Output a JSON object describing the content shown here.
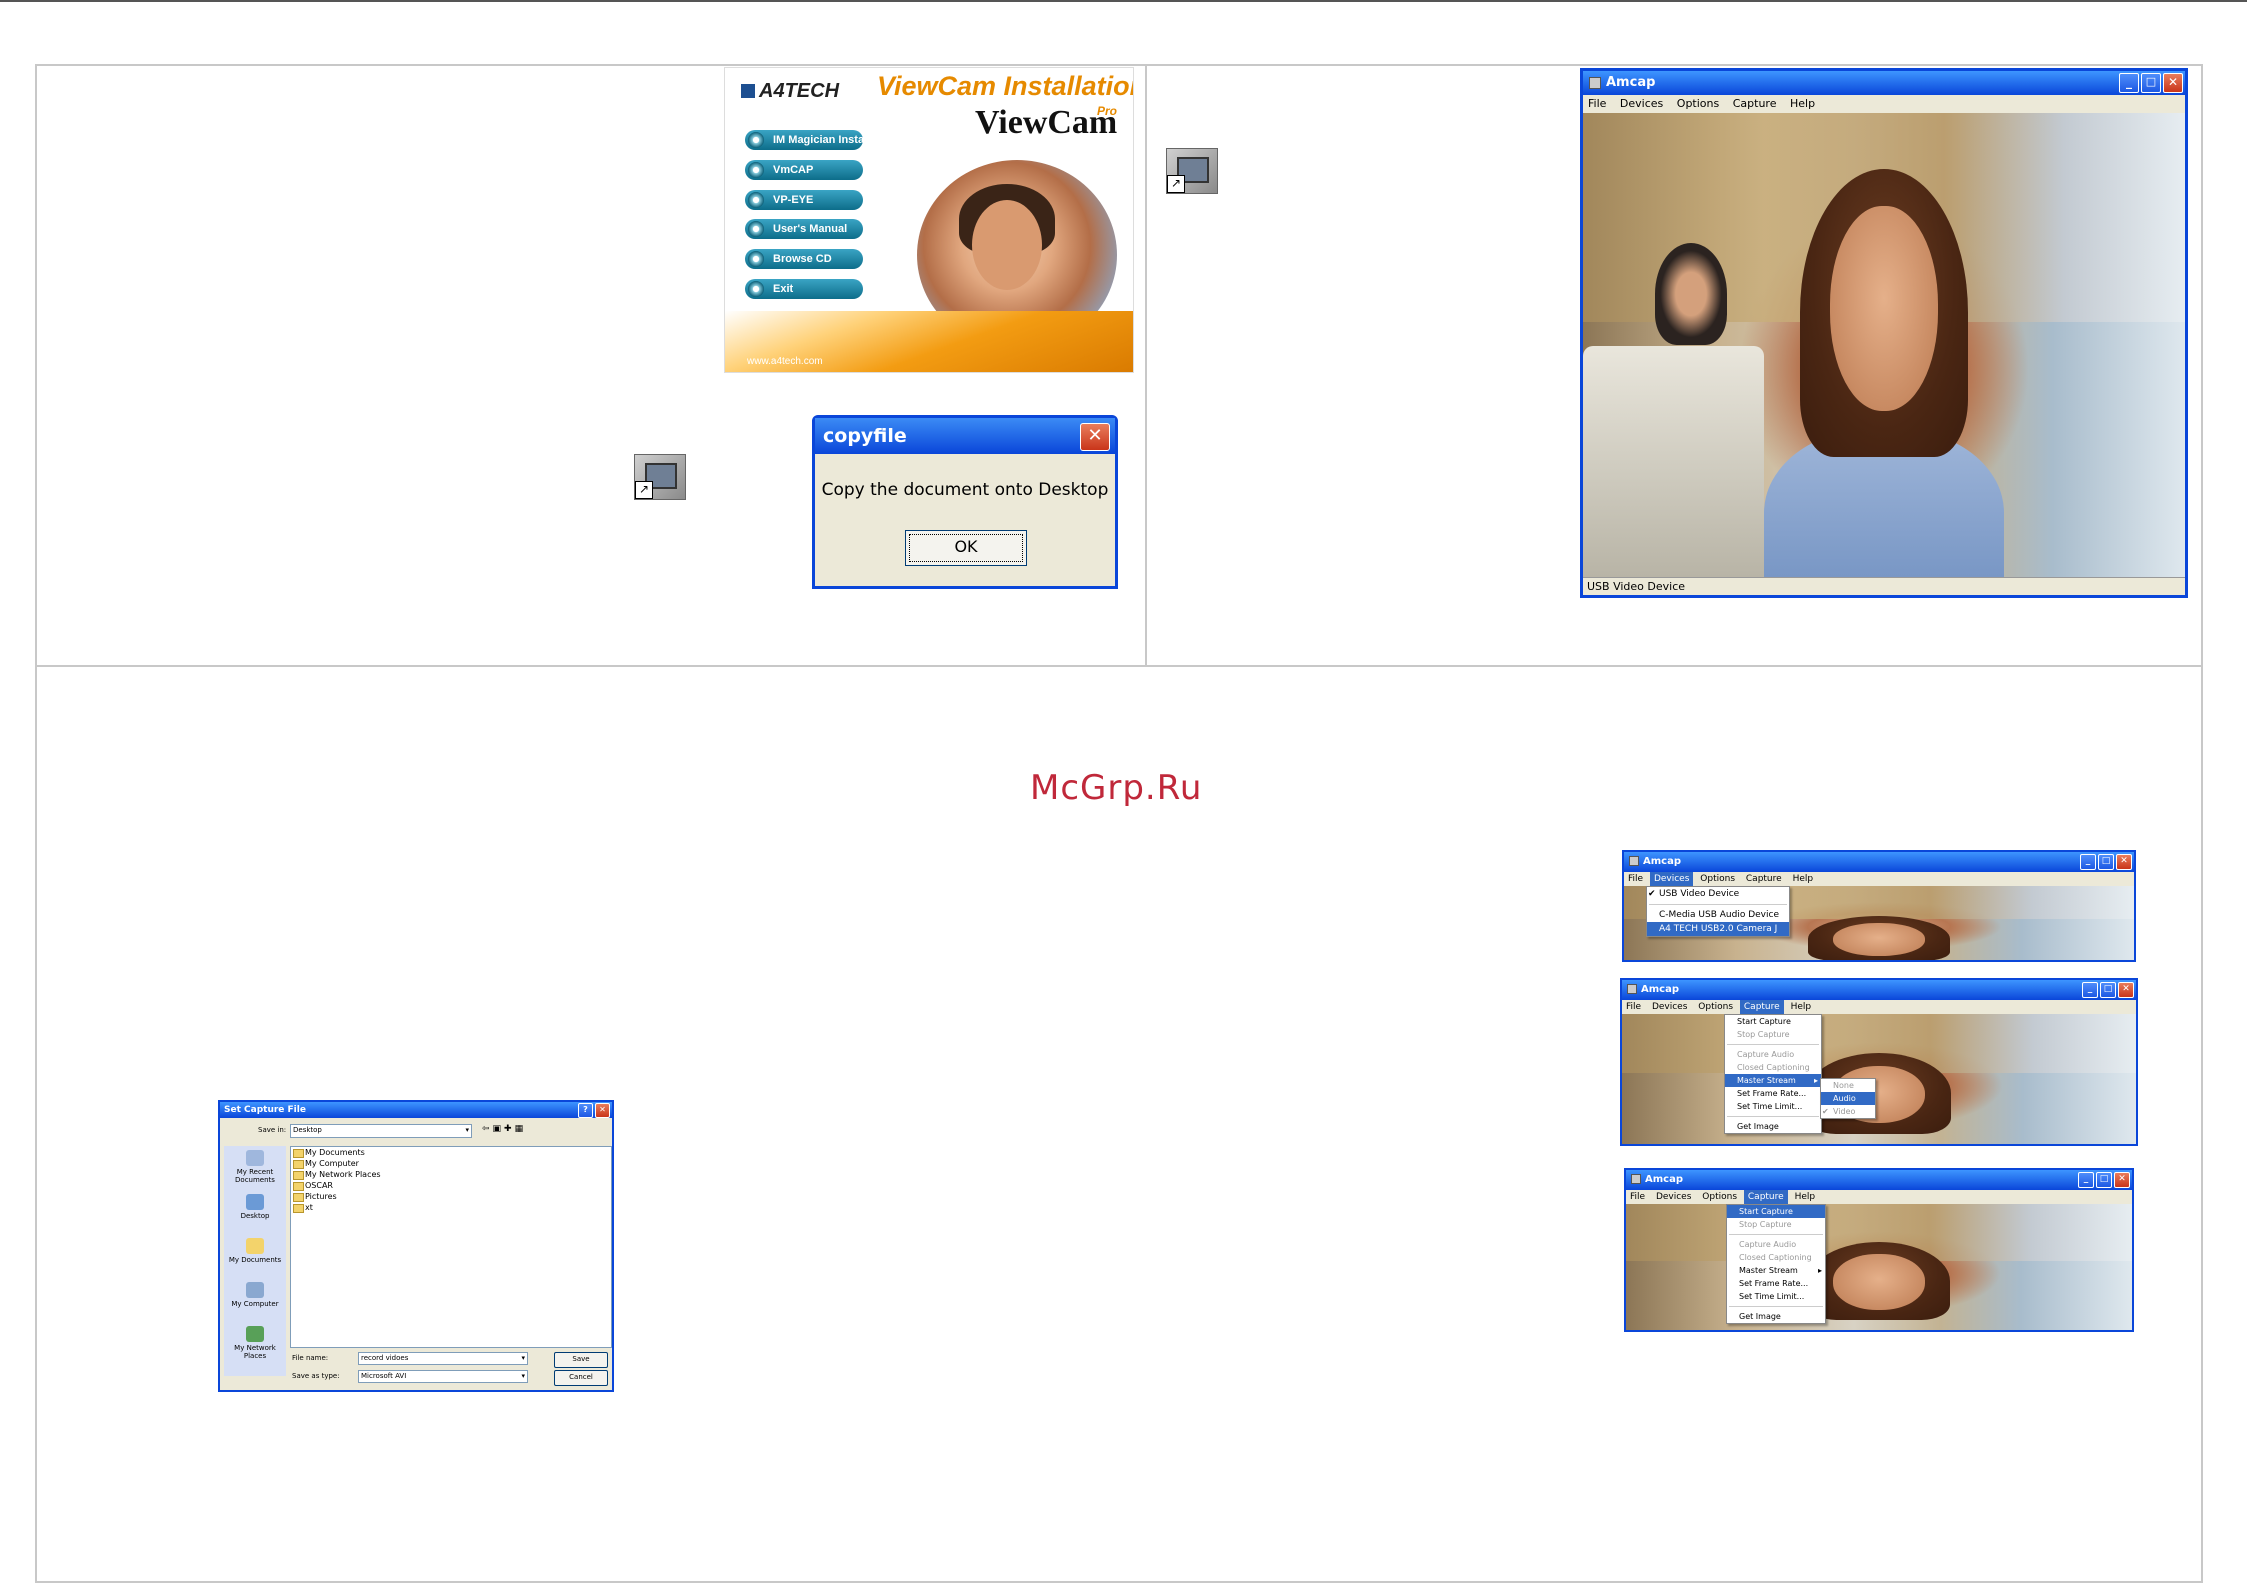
{
  "installer": {
    "brand": "A4TECH",
    "title": "ViewCam Installation",
    "logo": "ViewCam",
    "logo_pro": "Pro",
    "buttons": [
      "IM Magician Install",
      "VmCAP",
      "VP-EYE",
      "User's Manual",
      "Browse CD",
      "Exit"
    ],
    "url": "www.a4tech.com"
  },
  "copyfile_dialog": {
    "title": "copyfile",
    "message": "Copy the document onto Desktop",
    "ok": "OK"
  },
  "amcap_main": {
    "title": "Amcap",
    "menu": [
      "File",
      "Devices",
      "Options",
      "Capture",
      "Help"
    ],
    "status": "USB Video Device"
  },
  "amcap_devices": {
    "title": "Amcap",
    "menu": [
      "File",
      "Devices",
      "Options",
      "Capture",
      "Help"
    ],
    "selected_menu": "Devices",
    "items": [
      "USB Video Device",
      "C-Media USB Audio Device",
      "A4 TECH USB2.0 Camera J"
    ]
  },
  "amcap_capture_stream": {
    "title": "Amcap",
    "menu": [
      "File",
      "Devices",
      "Options",
      "Capture",
      "Help"
    ],
    "selected_menu": "Capture",
    "items": [
      "Start Capture",
      "Stop Capture",
      "Capture Audio",
      "Closed Captioning",
      "Master Stream",
      "Set Frame Rate...",
      "Set Time Limit...",
      "Get Image"
    ],
    "submenu": [
      "None",
      "Audio",
      "Video"
    ]
  },
  "amcap_capture_start": {
    "title": "Amcap",
    "menu": [
      "File",
      "Devices",
      "Options",
      "Capture",
      "Help"
    ],
    "selected_menu": "Capture",
    "items": [
      "Start Capture",
      "Stop Capture",
      "Capture Audio",
      "Closed Captioning",
      "Master Stream",
      "Set Frame Rate...",
      "Set Time Limit...",
      "Get Image"
    ]
  },
  "watermark": "McGrp.Ru",
  "save_dialog": {
    "title": "Set Capture File",
    "save_in_label": "Save in:",
    "save_in_value": "Desktop",
    "places": [
      "My Recent Documents",
      "Desktop",
      "My Documents",
      "My Computer",
      "My Network Places"
    ],
    "files": [
      "My Documents",
      "My Computer",
      "My Network Places",
      "OSCAR",
      "Pictures",
      "xt"
    ],
    "file_name_label": "File name:",
    "file_name_value": "record vidoes",
    "save_type_label": "Save as type:",
    "save_type_value": "Microsoft AVI",
    "save_button": "Save",
    "cancel_button": "Cancel"
  }
}
